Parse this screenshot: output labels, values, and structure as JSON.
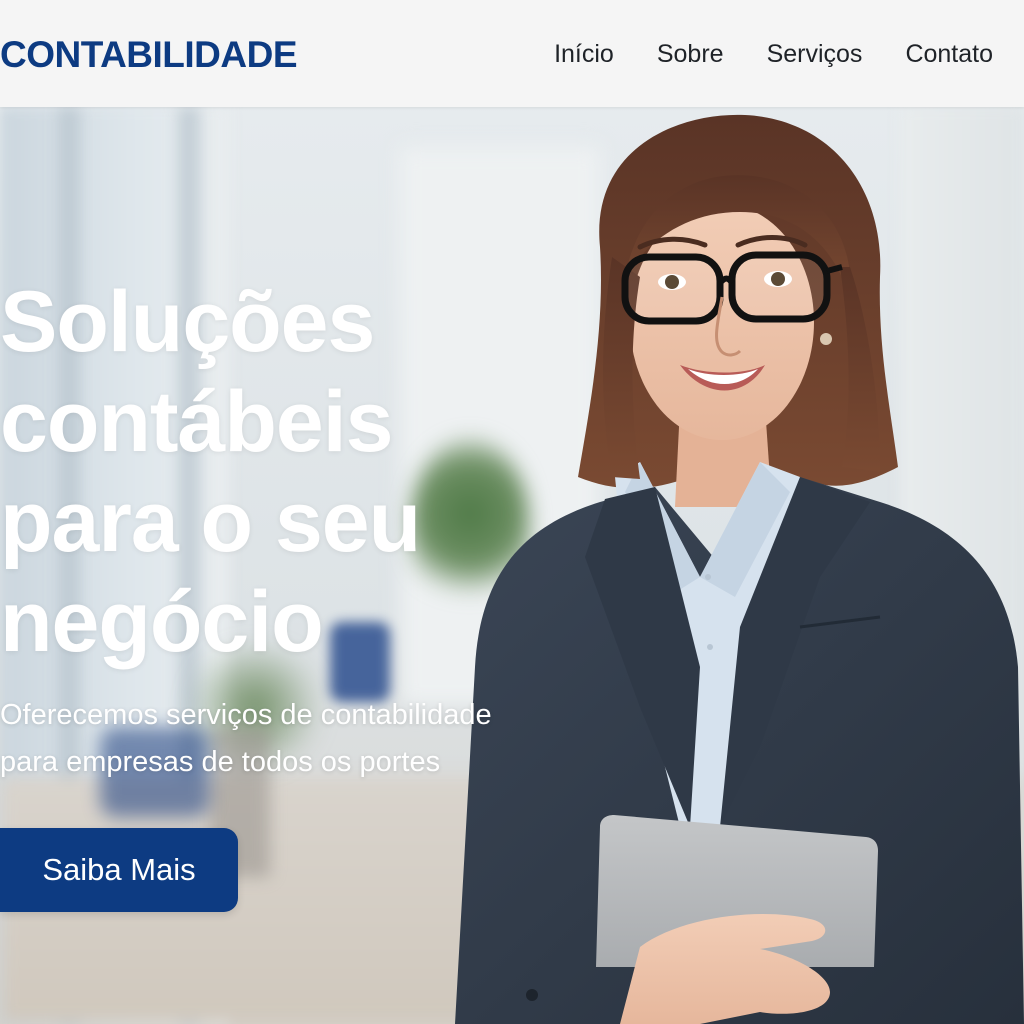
{
  "header": {
    "logo": "CONTABILIDADE",
    "nav": [
      {
        "label": "Início"
      },
      {
        "label": "Sobre"
      },
      {
        "label": "Serviços"
      },
      {
        "label": "Contato"
      }
    ]
  },
  "hero": {
    "title_lines": [
      "Soluções",
      "contábeis",
      "para o seu",
      "negócio"
    ],
    "subtitle_lines": [
      "Oferecemos serviços de contabilidade",
      "para empresas de todos os portes"
    ],
    "cta_label": "Saiba Mais"
  },
  "colors": {
    "brand": "#0d3b82",
    "header_bg": "#f5f5f5",
    "nav_text": "#1f2328",
    "hero_text": "#ffffff"
  }
}
